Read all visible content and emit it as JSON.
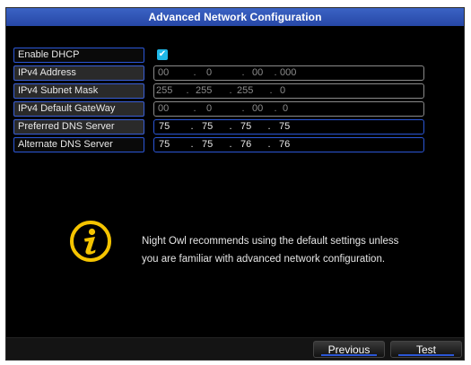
{
  "window": {
    "title": "Advanced Network Configuration"
  },
  "fields": {
    "dhcp": {
      "label": "Enable DHCP",
      "checked": true,
      "check_glyph": "✔"
    },
    "ipv4_address": {
      "label": "IPv4 Address",
      "octets": [
        "00",
        "0",
        "00",
        "000"
      ]
    },
    "subnet_mask": {
      "label": "IPv4 Subnet Mask",
      "octets": [
        "255",
        "255",
        "255",
        "0"
      ]
    },
    "gateway": {
      "label": "IPv4 Default GateWay",
      "octets": [
        "00",
        "0",
        "00",
        "0"
      ]
    },
    "preferred_dns": {
      "label": "Preferred DNS Server",
      "octets": [
        "75",
        "75",
        "75",
        "75"
      ]
    },
    "alternate_dns": {
      "label": "Alternate DNS Server",
      "octets": [
        "75",
        "75",
        "76",
        "76"
      ]
    }
  },
  "message": {
    "line1": "Night Owl recommends using the default settings unless",
    "line2": "you are familiar with advanced network configuration.",
    "icon": "info-icon"
  },
  "buttons": {
    "previous": "Previous",
    "test": "Test"
  },
  "colors": {
    "accent": "#2b56d6",
    "title_bar": "#3b63c4",
    "info_icon": "#f5c400",
    "checkbox": "#1fb8e8"
  }
}
